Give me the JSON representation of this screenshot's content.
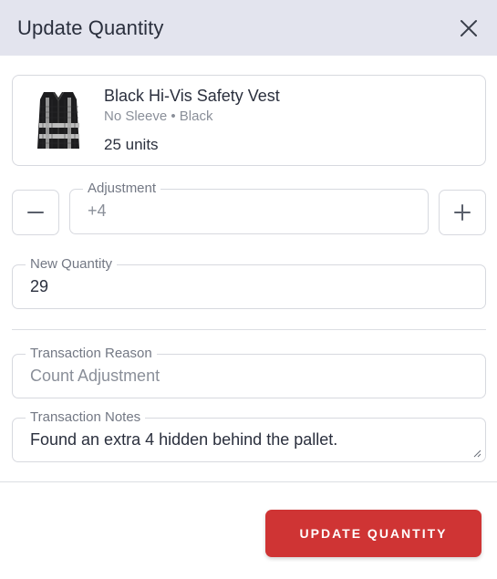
{
  "dialog": {
    "title": "Update Quantity"
  },
  "product": {
    "name": "Black Hi-Vis Safety Vest",
    "variant": "No Sleeve • Black",
    "quantity": "25 units"
  },
  "adjustment": {
    "label": "Adjustment",
    "value": "+4"
  },
  "new_quantity": {
    "label": "New Quantity",
    "value": "29"
  },
  "transaction_reason": {
    "label": "Transaction Reason",
    "value": "Count Adjustment"
  },
  "transaction_notes": {
    "label": "Transaction Notes",
    "value": "Found an extra 4 hidden behind the pallet."
  },
  "actions": {
    "submit_label": "UPDATE QUANTITY"
  },
  "colors": {
    "header_bg": "#e3e4ee",
    "accent": "#cf3434",
    "border": "#d7d9df"
  },
  "icons": {
    "close": "close-icon",
    "minus": "minus-icon",
    "plus": "plus-icon",
    "product": "safety-vest-image"
  }
}
